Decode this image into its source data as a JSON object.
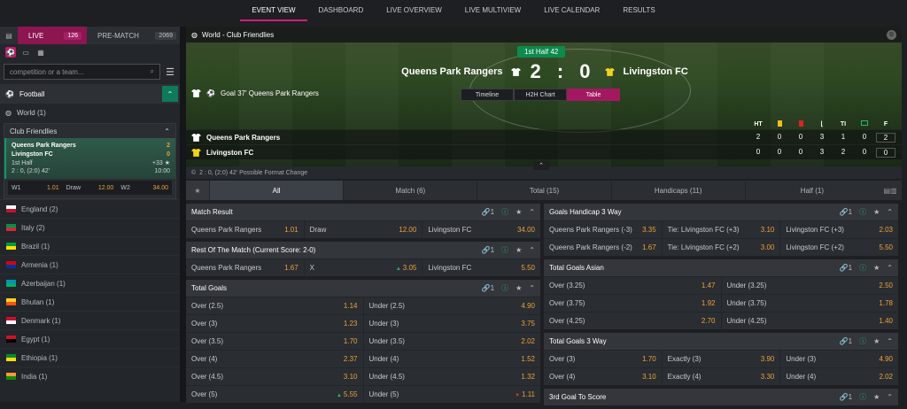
{
  "topnav": [
    "EVENT VIEW",
    "DASHBOARD",
    "LIVE OVERVIEW",
    "LIVE MULTIVIEW",
    "LIVE CALENDAR",
    "RESULTS"
  ],
  "left": {
    "live_label": "LIVE",
    "live_count": "126",
    "pre_label": "PRE-MATCH",
    "pre_count": "2069",
    "search_placeholder": "competition or a team...",
    "sport": "Football",
    "world": "World (1)",
    "competition": "Club Friendlies",
    "card": {
      "home": "Queens Park Rangers",
      "home_score": "2",
      "away": "Livingston FC",
      "away_score": "0",
      "period": "1st Half",
      "more": "+33",
      "detail": "2 : 0, (2:0) 42'",
      "time": "10:00"
    },
    "odds": [
      {
        "k": "W1",
        "v": "1.01"
      },
      {
        "k": "Draw",
        "v": "12.00"
      },
      {
        "k": "W2",
        "v": "34.00"
      }
    ],
    "countries": [
      {
        "name": "England (2)",
        "flag": [
          "#fff",
          "#c8102e"
        ]
      },
      {
        "name": "Italy (2)",
        "flag": [
          "#009246",
          "#ce2b37"
        ]
      },
      {
        "name": "Brazil (1)",
        "flag": [
          "#009c3b",
          "#ffdf00"
        ]
      },
      {
        "name": "Armenia (1)",
        "flag": [
          "#d90012",
          "#0033a0"
        ]
      },
      {
        "name": "Azerbaijan (1)",
        "flag": [
          "#0092bc",
          "#00af66"
        ]
      },
      {
        "name": "Bhutan (1)",
        "flag": [
          "#ffd520",
          "#ff4e12"
        ]
      },
      {
        "name": "Denmark (1)",
        "flag": [
          "#c8102e",
          "#fff"
        ]
      },
      {
        "name": "Egypt (1)",
        "flag": [
          "#ce1126",
          "#000"
        ]
      },
      {
        "name": "Ethiopia (1)",
        "flag": [
          "#078930",
          "#fcdd09"
        ]
      },
      {
        "name": "India (1)",
        "flag": [
          "#ff9933",
          "#138808"
        ]
      }
    ]
  },
  "hero": {
    "title": "World - Club Friendlies",
    "half": "1st Half 42",
    "home": "Queens Park Rangers",
    "away": "Livingston FC",
    "score": "2 : 0",
    "goal": "Goal 37' Queens Park Rangers",
    "tabs": [
      "Timeline",
      "H2H Chart",
      "Table"
    ],
    "cols": [
      "HT",
      "",
      "",
      "",
      "TI",
      "",
      "F"
    ],
    "rows": [
      {
        "name": "Queens Park Rangers",
        "vals": [
          "2",
          "0",
          "0",
          "3",
          "1",
          "0",
          "2"
        ]
      },
      {
        "name": "Livingston FC",
        "vals": [
          "0",
          "0",
          "0",
          "3",
          "2",
          "0",
          "0"
        ]
      }
    ],
    "footinfo": "2 : 0, (2:0) 42' Possible Format Change"
  },
  "markettabs": [
    "All",
    "Match (6)",
    "Total (15)",
    "Handicaps (11)",
    "Half (1)"
  ],
  "markets_left": [
    {
      "title": "Match Result",
      "link": "1",
      "rows": [
        [
          {
            "k": "Queens Park Rangers",
            "v": "1.01"
          },
          {
            "k": "Draw",
            "v": "12.00"
          },
          {
            "k": "Livingston FC",
            "v": "34.00"
          }
        ]
      ]
    },
    {
      "title": "Rest Of The Match (Current Score: 2-0)",
      "link": "1",
      "rows": [
        [
          {
            "k": "Queens Park Rangers",
            "v": "1.67"
          },
          {
            "k": "X",
            "v": "3.05",
            "t": "up"
          },
          {
            "k": "Livingston FC",
            "v": "5.50"
          }
        ]
      ]
    },
    {
      "title": "Total Goals",
      "link": "1",
      "rows": [
        [
          {
            "k": "Over (2.5)",
            "v": "1.14"
          },
          {
            "k": "Under (2.5)",
            "v": "4.90"
          }
        ],
        [
          {
            "k": "Over (3)",
            "v": "1.23"
          },
          {
            "k": "Under (3)",
            "v": "3.75"
          }
        ],
        [
          {
            "k": "Over (3.5)",
            "v": "1.70"
          },
          {
            "k": "Under (3.5)",
            "v": "2.02"
          }
        ],
        [
          {
            "k": "Over (4)",
            "v": "2.37"
          },
          {
            "k": "Under (4)",
            "v": "1.52"
          }
        ],
        [
          {
            "k": "Over (4.5)",
            "v": "3.10"
          },
          {
            "k": "Under (4.5)",
            "v": "1.32"
          }
        ],
        [
          {
            "k": "Over (5)",
            "v": "5.55",
            "t": "up"
          },
          {
            "k": "Under (5)",
            "v": "1.11",
            "t": "dn"
          }
        ]
      ]
    }
  ],
  "markets_right": [
    {
      "title": "Goals Handicap 3 Way",
      "link": "1",
      "rows": [
        [
          {
            "k": "Queens Park Rangers (-3)",
            "v": "3.35"
          },
          {
            "k": "Tie: Livingston FC (+3)",
            "v": "3.10"
          },
          {
            "k": "Livingston FC (+3)",
            "v": "2.03"
          }
        ],
        [
          {
            "k": "Queens Park Rangers (-2)",
            "v": "1.67"
          },
          {
            "k": "Tie: Livingston FC (+2)",
            "v": "3.00"
          },
          {
            "k": "Livingston FC (+2)",
            "v": "5.50"
          }
        ]
      ]
    },
    {
      "title": "Total Goals Asian",
      "link": "1",
      "rows": [
        [
          {
            "k": "Over (3.25)",
            "v": "1.47"
          },
          {
            "k": "Under (3.25)",
            "v": "2.50"
          }
        ],
        [
          {
            "k": "Over (3.75)",
            "v": "1.92"
          },
          {
            "k": "Under (3.75)",
            "v": "1.78"
          }
        ],
        [
          {
            "k": "Over (4.25)",
            "v": "2.70"
          },
          {
            "k": "Under (4.25)",
            "v": "1.40"
          }
        ]
      ]
    },
    {
      "title": "Total Goals 3 Way",
      "link": "1",
      "rows": [
        [
          {
            "k": "Over (3)",
            "v": "1.70"
          },
          {
            "k": "Exactly (3)",
            "v": "3.90"
          },
          {
            "k": "Under (3)",
            "v": "4.90"
          }
        ],
        [
          {
            "k": "Over (4)",
            "v": "3.10"
          },
          {
            "k": "Exactly (4)",
            "v": "3.30"
          },
          {
            "k": "Under (4)",
            "v": "2.02"
          }
        ]
      ]
    },
    {
      "title": "3rd Goal To Score",
      "link": "1",
      "rows": []
    }
  ]
}
